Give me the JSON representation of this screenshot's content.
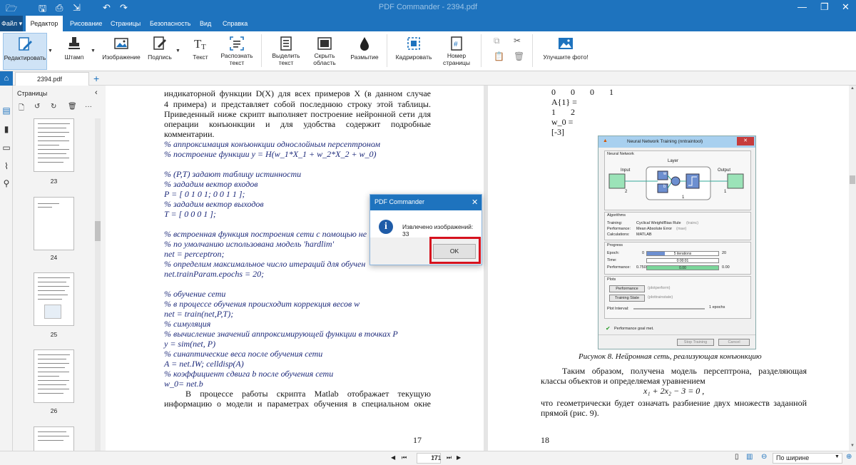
{
  "app": {
    "title": "PDF Commander - 2394.pdf"
  },
  "quick_access": {
    "icons": [
      "folder-open-icon",
      "save-icon",
      "print-icon",
      "pdf-export-icon",
      "undo-icon",
      "redo-icon"
    ]
  },
  "ribbon_tabs": [
    {
      "label": "Файл"
    },
    {
      "label": "Редактор",
      "active": true
    },
    {
      "label": "Рисование"
    },
    {
      "label": "Страницы"
    },
    {
      "label": "Безопасность"
    },
    {
      "label": "Вид"
    },
    {
      "label": "Справка"
    }
  ],
  "ribbon": {
    "edit": "Редактировать",
    "stamp": "Штамп",
    "image": "Изображение",
    "signature": "Подпись",
    "text": "Текст",
    "ocr_1": "Распознать",
    "ocr_2": "текст",
    "select_1": "Выделить",
    "select_2": "текст",
    "hide_1": "Скрыть",
    "hide_2": "область",
    "blur": "Размытие",
    "crop": "Кадрировать",
    "pagenum_1": "Номер",
    "pagenum_2": "страницы",
    "photo": "Улучшите фото!"
  },
  "doc_tab": {
    "name": "2394.pdf"
  },
  "pages_panel": {
    "title": "Страницы",
    "thumbs": [
      {
        "num": "23"
      },
      {
        "num": "24"
      },
      {
        "num": "25"
      },
      {
        "num": "26"
      }
    ]
  },
  "page_left": {
    "lines": [
      "индикаторной функции D(X) для всех примеров X (в данном случае",
      "4 примера) и представляет собой последнюю строку этой таблицы.",
      "Приведенный ниже скрипт выполняет построение нейронной сети для",
      "операции конъюнкции и для удобства содержит подробные",
      "комментарии.",
      "% аппроксимация конъюнкции однослойным персептроном",
      "% построение функции y = H(w_1*X_1 + w_2*X_2 + w_0)",
      "",
      "% (P,T) задают таблицу истинности",
      "% зададим вектор входов",
      "P = [ 0 1 0 1; 0 0 1 1 ];",
      "% зададим вектор выходов",
      "T = [ 0 0 0 1 ];",
      "",
      "% встроенная функция построения сети с помощью не",
      "% по умолчанию использована модель 'hardlim'",
      "net = perceptron;",
      "% определим максимальное число итераций для обучен",
      "net.trainParam.epochs = 20;",
      "",
      "% обучение сети",
      "% в процессе обучения происходит коррекция весов w",
      "net = train(net,P,T);",
      "% симуляция",
      "% вычисление значений аппроксимирующей функции в точках P",
      "y = sim(net, P)",
      "% синаптические веса после обучения сети",
      "A = net.IW; celldisp(A)",
      "% коэффициент сдвига b после обучения сети",
      "w_0= net.b",
      "В процессе работы скрипта Matlab отображает текущую",
      "информацию о модели и параметрах обучения в специальном окне"
    ],
    "page_number": "17"
  },
  "page_right": {
    "top_lines": [
      "0 0 0 1",
      "A{1} =",
      "1 2",
      "w_0 =",
      "[-3]"
    ],
    "caption": "Рисунок 8. Нейронная сеть, реализующая конъюнкцию",
    "lines": [
      "Таким образом, получена модель персептрона, разделяющая",
      "классы объектов и определяемая уравнением",
      "x₁ + 2x₂ − 3 = 0 ,",
      "что геометрически будет означать разбиение двух множеств заданной",
      "прямой (рис. 9)."
    ],
    "page_number": "18"
  },
  "nn_window": {
    "title": "Neural Network Training (nntraintool)",
    "section_network": "Neural Network",
    "layer": "Layer",
    "input": "Input",
    "output": "Output",
    "input_n": "2",
    "output_n": "1",
    "layer_n": "1",
    "w": "w",
    "b": "b",
    "section_algorithms": "Algorithms",
    "training_label": "Training:",
    "training_value": "Cyclical Weight/Bias Rule",
    "training_fn": "(trainc)",
    "perf_label": "Performance:",
    "perf_value": "Mean Absolute Error",
    "perf_fn": "(mae)",
    "calc_label": "Calculations:",
    "calc_value": "MATLAB",
    "section_progress": "Progress",
    "epoch_label": "Epoch:",
    "epoch_min": "0",
    "epoch_bar": "5 iterations",
    "epoch_max": "20",
    "time_label": "Time:",
    "time_bar": "0:00:01",
    "perfp_label": "Performance:",
    "perfp_min": "0.750",
    "perfp_bar": "0.00",
    "perfp_max": "0.00",
    "section_plots": "Plots",
    "plot1": "Performance",
    "plot1_fn": "(plotperform)",
    "plot2": "Training State",
    "plot2_fn": "(plottrainstate)",
    "interval_label": "Plot Interval:",
    "interval_value": "1 epochs",
    "status": "Performance goal met.",
    "stop": "Stop Training",
    "cancel": "Cancel"
  },
  "dialog": {
    "title": "PDF Commander",
    "message": "Извлечено изображений: 33",
    "ok": "OK"
  },
  "status_bar": {
    "current_page": "17",
    "total": "/71",
    "zoom": "По ширине"
  }
}
